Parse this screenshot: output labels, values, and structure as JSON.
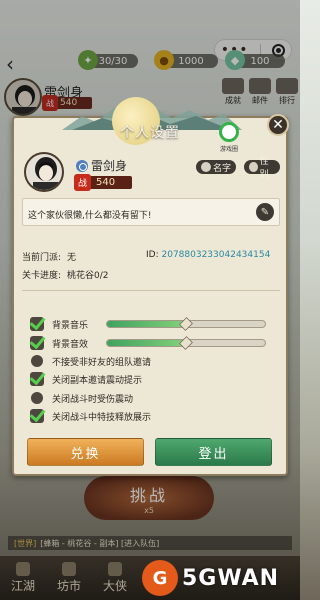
{
  "capsule": {
    "more_icon": "more-dots-icon",
    "close_icon": "target-close-icon"
  },
  "resources": {
    "stamina": "30/30",
    "gold": "1000",
    "jade": "100"
  },
  "background_player": {
    "name": "雷剑身",
    "power": "540",
    "power_badge": "战"
  },
  "background_menu": [
    "成就",
    "邮件",
    "排行"
  ],
  "modal": {
    "title": "个人设置",
    "game_circle_label": "游戏圈",
    "player": {
      "name": "雷剑身",
      "power": "540",
      "power_badge": "战"
    },
    "rename_button": "名字",
    "gender_button": "性别",
    "signature": "这个家伙很懒,什么都没有留下!",
    "sect_label": "当前门派:",
    "sect_value": "无",
    "id_label": "ID:",
    "id_value": "2078803233042434154",
    "stage_label": "关卡进度:",
    "stage_value": "桃花谷0/2",
    "options": [
      {
        "label": "背景音乐",
        "type": "checkbox",
        "checked": true,
        "slider_value": 0.5
      },
      {
        "label": "背景音效",
        "type": "checkbox",
        "checked": true,
        "slider_value": 0.5
      },
      {
        "label": "不接受非好友的组队邀请",
        "type": "radio",
        "checked": false
      },
      {
        "label": "关闭副本邀请震动提示",
        "type": "checkbox",
        "checked": true
      },
      {
        "label": "关闭战斗时受伤震动",
        "type": "radio",
        "checked": false
      },
      {
        "label": "关闭战斗中特技释放展示",
        "type": "checkbox",
        "checked": true
      }
    ],
    "redeem_button": "兑换",
    "logout_button": "登出"
  },
  "challenge": {
    "label": "挑战",
    "count": "x5"
  },
  "chat": {
    "tag": "[世界]",
    "message": "[蜂箱 - 桃花谷 - 副本] [进入队伍]"
  },
  "bottom_nav": [
    "江湖",
    "坊市",
    "大侠"
  ],
  "watermark": {
    "logo_glyph": "G",
    "text": "5GWAN"
  },
  "colors": {
    "panel_bg": "#ede7d6",
    "redeem": "#e0943b",
    "logout": "#3d9660",
    "id_color": "#2a8aa0",
    "check_green": "#55d04a"
  }
}
